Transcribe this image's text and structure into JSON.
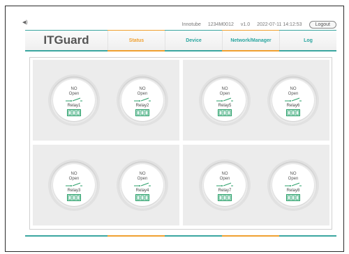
{
  "topbar": {
    "brand_name": "Innotube",
    "device_id": "1234M0012",
    "version": "v1.0",
    "datetime": "2022-07-11 14:12:53",
    "logout_label": "Logout",
    "speaker_icon": "speaker-icon"
  },
  "nav": {
    "brand": "ITGuard",
    "tabs": [
      {
        "label": "Status",
        "active": true
      },
      {
        "label": "Device",
        "active": false
      },
      {
        "label": "Network/Manager",
        "active": false
      },
      {
        "label": "Log",
        "active": false
      }
    ]
  },
  "relays": [
    {
      "mode": "NO",
      "state": "Open",
      "name": "Relay1"
    },
    {
      "mode": "NO",
      "state": "Open",
      "name": "Relay2"
    },
    {
      "mode": "NO",
      "state": "Open",
      "name": "Relay5"
    },
    {
      "mode": "NO",
      "state": "Open",
      "name": "Relay6"
    },
    {
      "mode": "NO",
      "state": "Open",
      "name": "Relay3"
    },
    {
      "mode": "NO",
      "state": "Open",
      "name": "Relay4"
    },
    {
      "mode": "NO",
      "state": "Open",
      "name": "Relay7"
    },
    {
      "mode": "NO",
      "state": "Open",
      "name": "Relay8"
    }
  ],
  "colors": {
    "accent_teal": "#3aa6a0",
    "accent_orange": "#f0a030",
    "switch_green": "#2aa06a"
  }
}
